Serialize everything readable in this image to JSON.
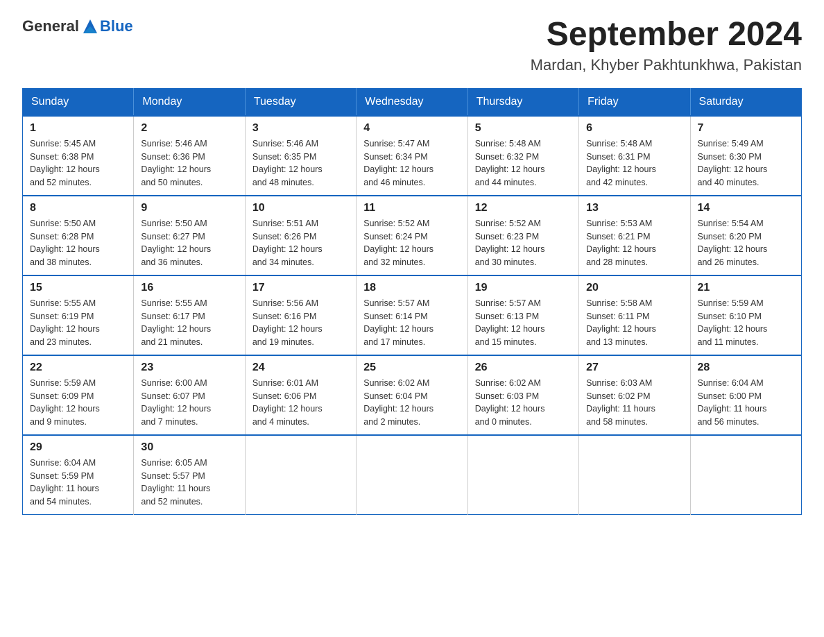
{
  "header": {
    "logo_general": "General",
    "logo_blue": "Blue",
    "month_year": "September 2024",
    "location": "Mardan, Khyber Pakhtunkhwa, Pakistan"
  },
  "weekdays": [
    "Sunday",
    "Monday",
    "Tuesday",
    "Wednesday",
    "Thursday",
    "Friday",
    "Saturday"
  ],
  "weeks": [
    [
      {
        "day": "1",
        "sunrise": "5:45 AM",
        "sunset": "6:38 PM",
        "daylight": "12 hours and 52 minutes."
      },
      {
        "day": "2",
        "sunrise": "5:46 AM",
        "sunset": "6:36 PM",
        "daylight": "12 hours and 50 minutes."
      },
      {
        "day": "3",
        "sunrise": "5:46 AM",
        "sunset": "6:35 PM",
        "daylight": "12 hours and 48 minutes."
      },
      {
        "day": "4",
        "sunrise": "5:47 AM",
        "sunset": "6:34 PM",
        "daylight": "12 hours and 46 minutes."
      },
      {
        "day": "5",
        "sunrise": "5:48 AM",
        "sunset": "6:32 PM",
        "daylight": "12 hours and 44 minutes."
      },
      {
        "day": "6",
        "sunrise": "5:48 AM",
        "sunset": "6:31 PM",
        "daylight": "12 hours and 42 minutes."
      },
      {
        "day": "7",
        "sunrise": "5:49 AM",
        "sunset": "6:30 PM",
        "daylight": "12 hours and 40 minutes."
      }
    ],
    [
      {
        "day": "8",
        "sunrise": "5:50 AM",
        "sunset": "6:28 PM",
        "daylight": "12 hours and 38 minutes."
      },
      {
        "day": "9",
        "sunrise": "5:50 AM",
        "sunset": "6:27 PM",
        "daylight": "12 hours and 36 minutes."
      },
      {
        "day": "10",
        "sunrise": "5:51 AM",
        "sunset": "6:26 PM",
        "daylight": "12 hours and 34 minutes."
      },
      {
        "day": "11",
        "sunrise": "5:52 AM",
        "sunset": "6:24 PM",
        "daylight": "12 hours and 32 minutes."
      },
      {
        "day": "12",
        "sunrise": "5:52 AM",
        "sunset": "6:23 PM",
        "daylight": "12 hours and 30 minutes."
      },
      {
        "day": "13",
        "sunrise": "5:53 AM",
        "sunset": "6:21 PM",
        "daylight": "12 hours and 28 minutes."
      },
      {
        "day": "14",
        "sunrise": "5:54 AM",
        "sunset": "6:20 PM",
        "daylight": "12 hours and 26 minutes."
      }
    ],
    [
      {
        "day": "15",
        "sunrise": "5:55 AM",
        "sunset": "6:19 PM",
        "daylight": "12 hours and 23 minutes."
      },
      {
        "day": "16",
        "sunrise": "5:55 AM",
        "sunset": "6:17 PM",
        "daylight": "12 hours and 21 minutes."
      },
      {
        "day": "17",
        "sunrise": "5:56 AM",
        "sunset": "6:16 PM",
        "daylight": "12 hours and 19 minutes."
      },
      {
        "day": "18",
        "sunrise": "5:57 AM",
        "sunset": "6:14 PM",
        "daylight": "12 hours and 17 minutes."
      },
      {
        "day": "19",
        "sunrise": "5:57 AM",
        "sunset": "6:13 PM",
        "daylight": "12 hours and 15 minutes."
      },
      {
        "day": "20",
        "sunrise": "5:58 AM",
        "sunset": "6:11 PM",
        "daylight": "12 hours and 13 minutes."
      },
      {
        "day": "21",
        "sunrise": "5:59 AM",
        "sunset": "6:10 PM",
        "daylight": "12 hours and 11 minutes."
      }
    ],
    [
      {
        "day": "22",
        "sunrise": "5:59 AM",
        "sunset": "6:09 PM",
        "daylight": "12 hours and 9 minutes."
      },
      {
        "day": "23",
        "sunrise": "6:00 AM",
        "sunset": "6:07 PM",
        "daylight": "12 hours and 7 minutes."
      },
      {
        "day": "24",
        "sunrise": "6:01 AM",
        "sunset": "6:06 PM",
        "daylight": "12 hours and 4 minutes."
      },
      {
        "day": "25",
        "sunrise": "6:02 AM",
        "sunset": "6:04 PM",
        "daylight": "12 hours and 2 minutes."
      },
      {
        "day": "26",
        "sunrise": "6:02 AM",
        "sunset": "6:03 PM",
        "daylight": "12 hours and 0 minutes."
      },
      {
        "day": "27",
        "sunrise": "6:03 AM",
        "sunset": "6:02 PM",
        "daylight": "11 hours and 58 minutes."
      },
      {
        "day": "28",
        "sunrise": "6:04 AM",
        "sunset": "6:00 PM",
        "daylight": "11 hours and 56 minutes."
      }
    ],
    [
      {
        "day": "29",
        "sunrise": "6:04 AM",
        "sunset": "5:59 PM",
        "daylight": "11 hours and 54 minutes."
      },
      {
        "day": "30",
        "sunrise": "6:05 AM",
        "sunset": "5:57 PM",
        "daylight": "11 hours and 52 minutes."
      },
      null,
      null,
      null,
      null,
      null
    ]
  ],
  "labels": {
    "sunrise": "Sunrise:",
    "sunset": "Sunset:",
    "daylight": "Daylight:"
  }
}
